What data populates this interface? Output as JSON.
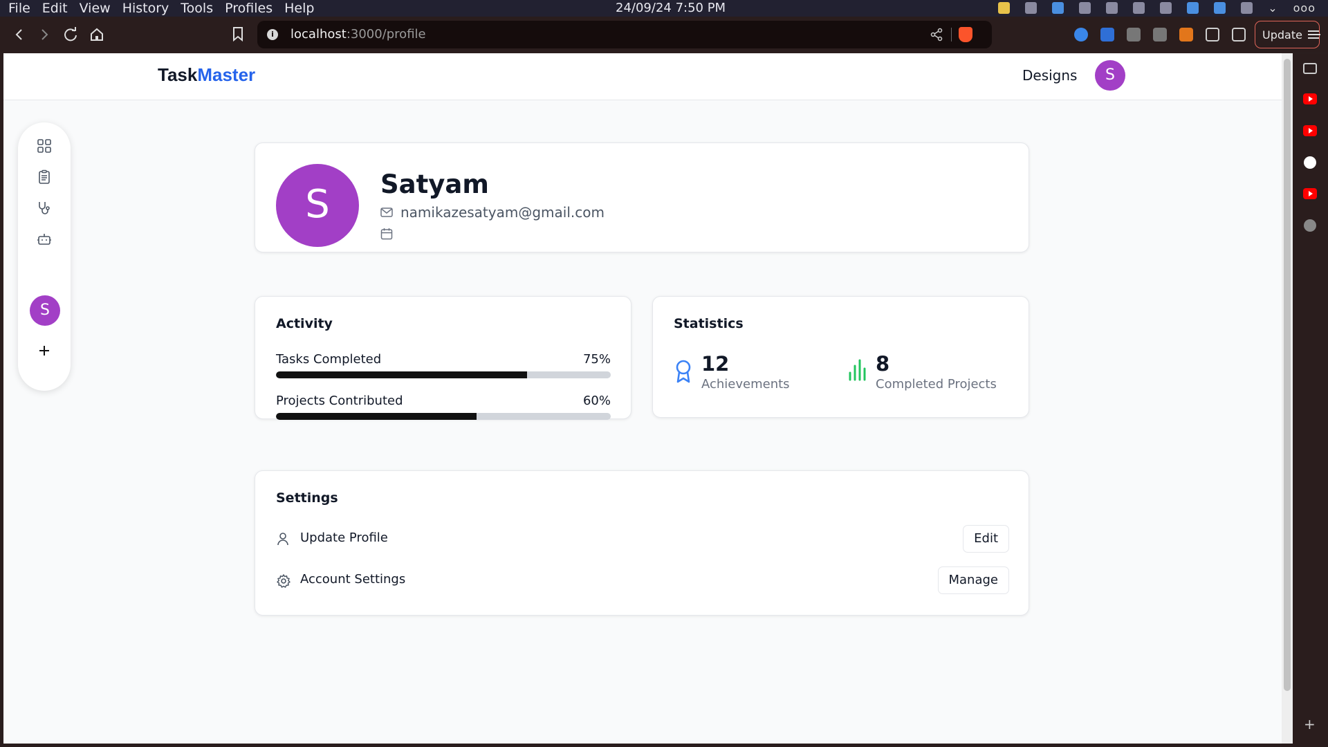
{
  "os": {
    "menu": [
      "File",
      "Edit",
      "View",
      "History",
      "Tools",
      "Profiles",
      "Help"
    ],
    "clock": "24/09/24 7:50 PM"
  },
  "browser": {
    "url_host": "localhost",
    "url_rest": ":3000/profile",
    "update_label": "Update"
  },
  "app": {
    "brand_part1": "Task",
    "brand_part2": "Master",
    "brand_accent_color": "#2563eb",
    "nav_designs": "Designs",
    "user_initial": "S",
    "avatar_color": "#a23fc6"
  },
  "sidebar": {
    "items": [
      "dashboard-icon",
      "clipboard-icon",
      "stethoscope-icon",
      "bot-icon"
    ],
    "avatar_initial": "S",
    "add_icon": "plus-icon"
  },
  "profile": {
    "initial": "S",
    "name": "Satyam",
    "email": "namikazesatyam@gmail.com"
  },
  "activity": {
    "title": "Activity",
    "rows": [
      {
        "label": "Tasks Completed",
        "percent_label": "75%",
        "value": 0.75
      },
      {
        "label": "Projects Contributed",
        "percent_label": "60%",
        "value": 0.6
      }
    ]
  },
  "statistics": {
    "title": "Statistics",
    "items": [
      {
        "value": "12",
        "caption": "Achievements",
        "icon": "award-icon",
        "color": "#3b82f6"
      },
      {
        "value": "8",
        "caption": "Completed Projects",
        "icon": "bar-chart-icon",
        "color": "#22c55e"
      }
    ]
  },
  "settings": {
    "title": "Settings",
    "rows": [
      {
        "label": "Update Profile",
        "button": "Edit",
        "icon": "user-icon"
      },
      {
        "label": "Account Settings",
        "button": "Manage",
        "icon": "gear-icon"
      }
    ]
  }
}
